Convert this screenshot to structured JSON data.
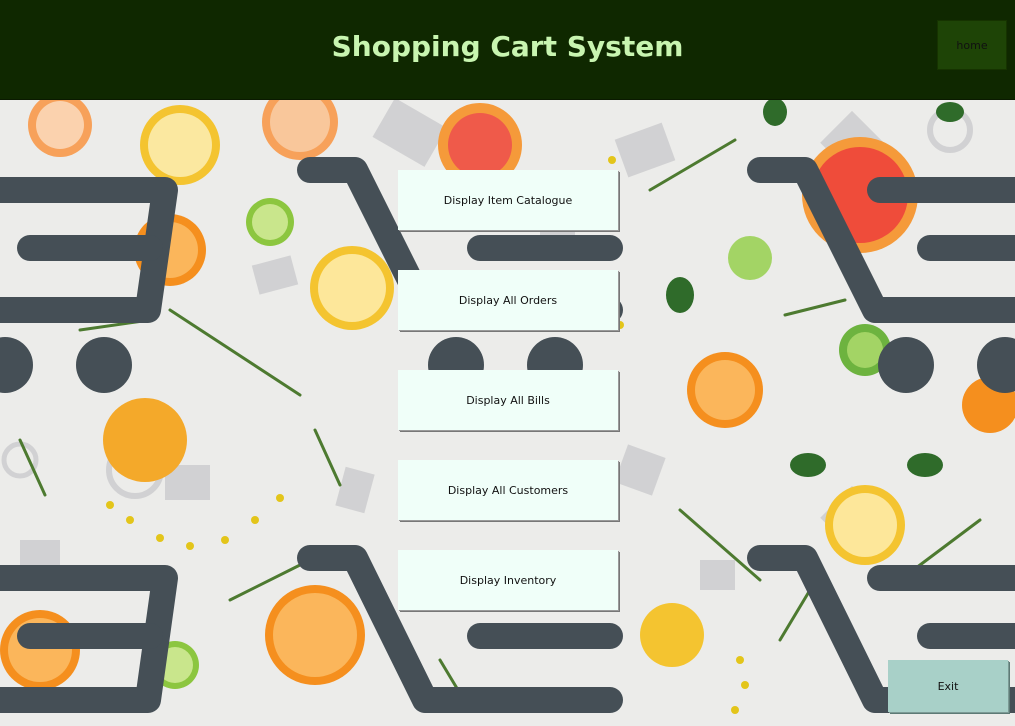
{
  "app": {
    "title": "Shopping Cart System",
    "home_label": "home",
    "exit_label": "Exit"
  },
  "menu": {
    "items": [
      {
        "id": "item-catalogue",
        "label": "Display Item Catalogue"
      },
      {
        "id": "all-orders",
        "label": "Display All Orders"
      },
      {
        "id": "all-bills",
        "label": "Display All Bills"
      },
      {
        "id": "all-customers",
        "label": "Display All Customers"
      },
      {
        "id": "inventory",
        "label": "Display Inventory"
      }
    ]
  },
  "colors": {
    "header_bg": "#0f2800",
    "title_text": "#c8f5b0",
    "home_bg": "#1e4406",
    "menu_bg": "#f0fff9",
    "exit_bg": "#a8d0c8",
    "cart_icon": "#454f56"
  },
  "decor": {
    "background": "shopping-cart-pattern-with-citrus-fruits"
  }
}
